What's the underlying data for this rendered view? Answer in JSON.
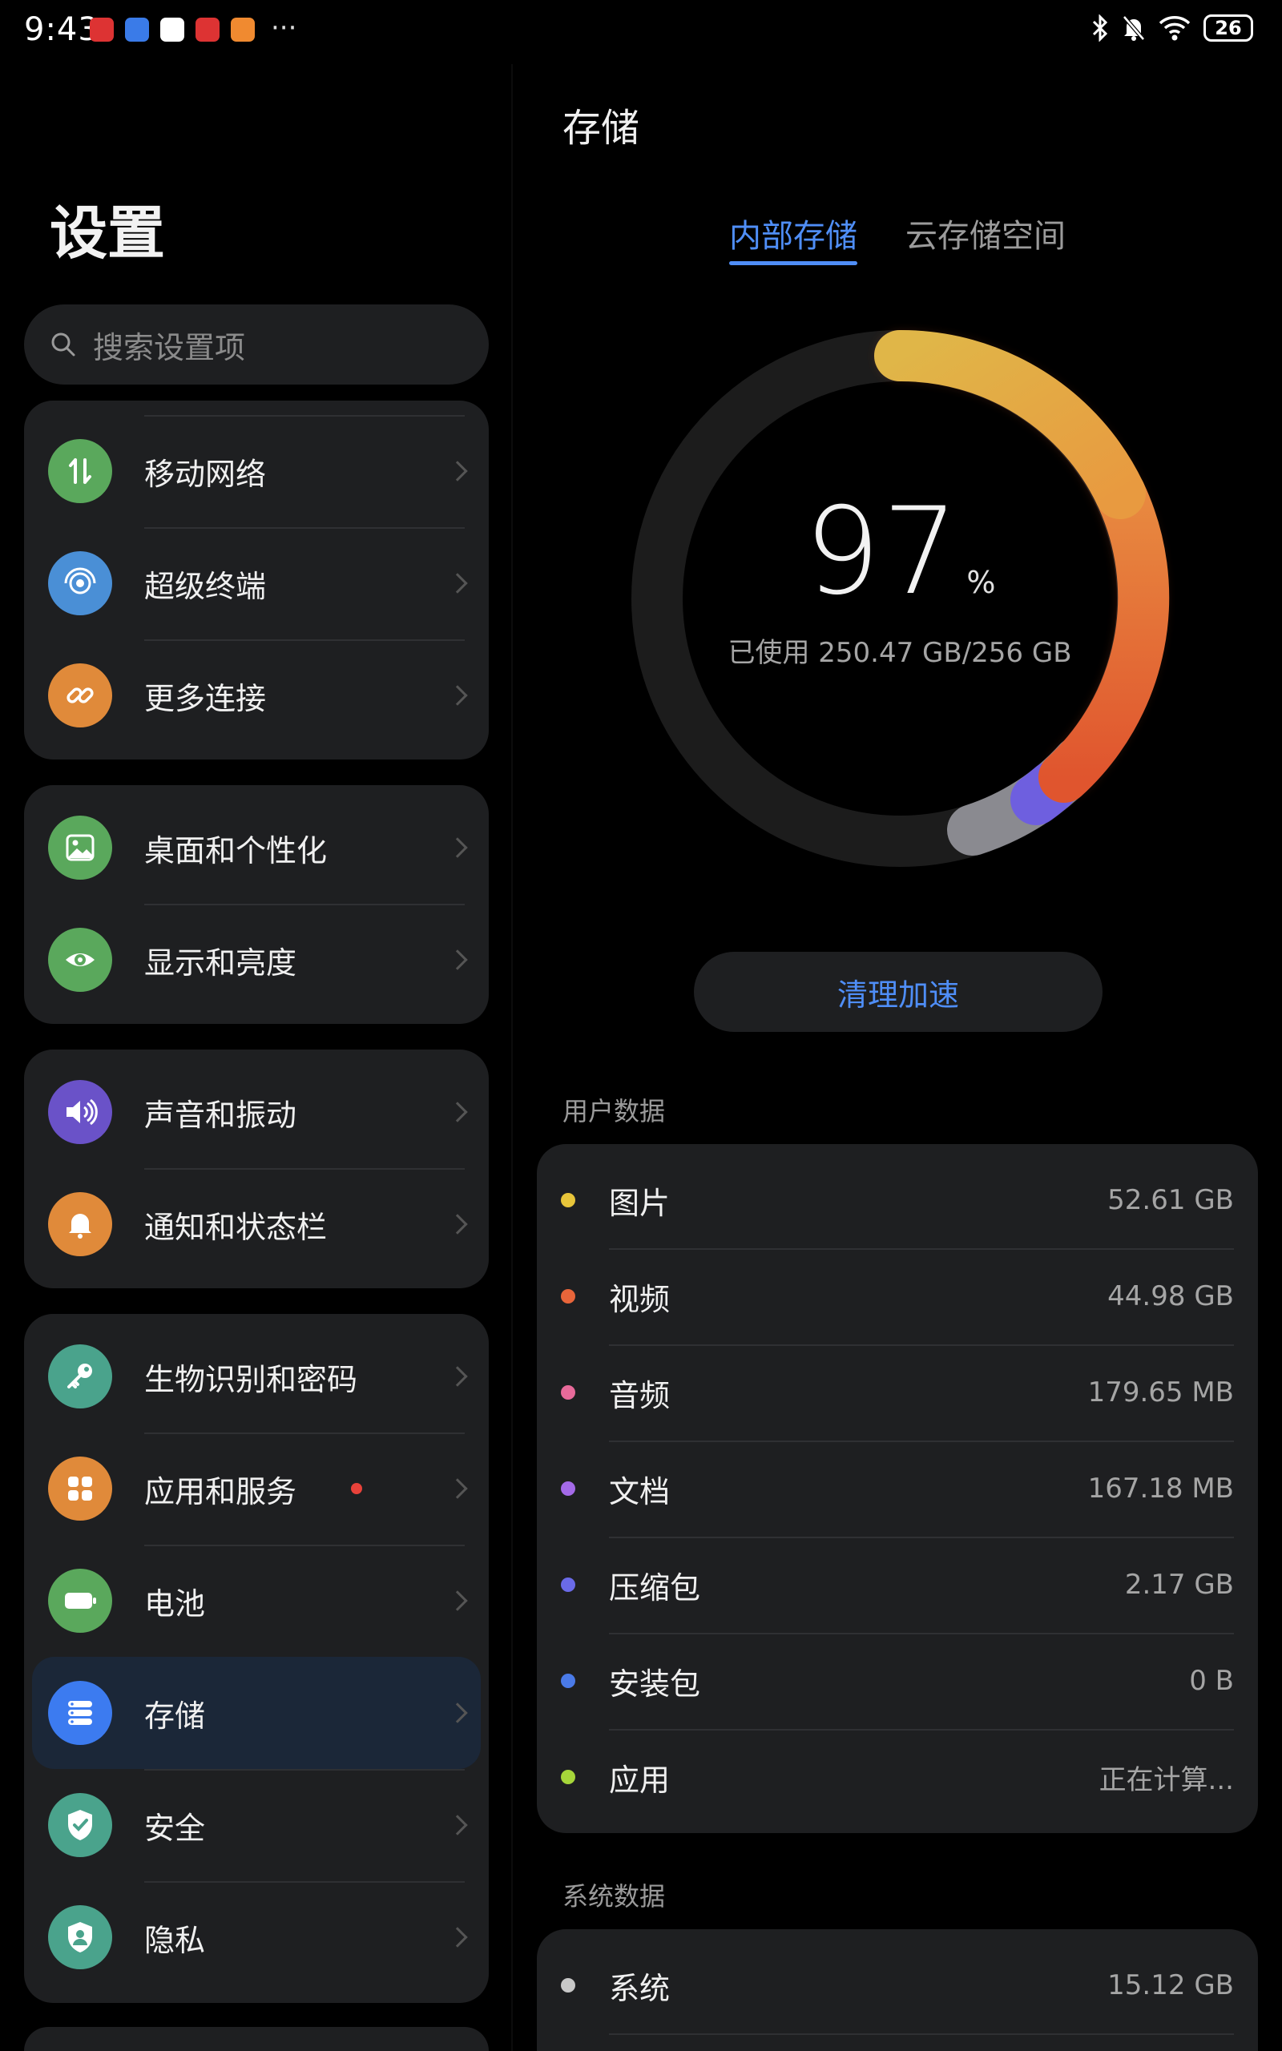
{
  "status_bar": {
    "time": "9:43",
    "battery": "26",
    "more": "···"
  },
  "left": {
    "title": "设置",
    "search_placeholder": "搜索设置项",
    "groups": [
      [
        {
          "label": "移动网络",
          "icon": "mobile-network-icon",
          "color": "#5aa85c"
        },
        {
          "label": "超级终端",
          "icon": "super-device-icon",
          "color": "#4a8fd6"
        },
        {
          "label": "更多连接",
          "icon": "link-icon",
          "color": "#e08a3a"
        }
      ],
      [
        {
          "label": "桌面和个性化",
          "icon": "wallpaper-icon",
          "color": "#5aa85c"
        },
        {
          "label": "显示和亮度",
          "icon": "eye-icon",
          "color": "#5aa85c"
        }
      ],
      [
        {
          "label": "声音和振动",
          "icon": "speaker-icon",
          "color": "#6a52c8"
        },
        {
          "label": "通知和状态栏",
          "icon": "bell-icon",
          "color": "#e08a3a"
        }
      ],
      [
        {
          "label": "生物识别和密码",
          "icon": "key-icon",
          "color": "#4aa38c"
        },
        {
          "label": "应用和服务",
          "icon": "apps-grid-icon",
          "color": "#e08a3a",
          "badge": true
        },
        {
          "label": "电池",
          "icon": "battery-icon",
          "color": "#5aa85c"
        },
        {
          "label": "存储",
          "icon": "storage-icon",
          "color": "#3c7bf0",
          "selected": true
        },
        {
          "label": "安全",
          "icon": "shield-check-icon",
          "color": "#4aa38c"
        },
        {
          "label": "隐私",
          "icon": "privacy-icon",
          "color": "#4aa38c"
        }
      ]
    ]
  },
  "right": {
    "title": "存储",
    "tabs": [
      "内部存储",
      "云存储空间"
    ],
    "percent": "97",
    "percent_symbol": "%",
    "used_text": "已使用 250.47 GB/256 GB",
    "clean_button": "清理加速",
    "user_section": "用户数据",
    "user_items": [
      {
        "name": "图片",
        "value": "52.61 GB",
        "color": "#e8c53a"
      },
      {
        "name": "视频",
        "value": "44.98 GB",
        "color": "#e8653a"
      },
      {
        "name": "音频",
        "value": "179.65 MB",
        "color": "#e86a9a"
      },
      {
        "name": "文档",
        "value": "167.18 MB",
        "color": "#a46ae8"
      },
      {
        "name": "压缩包",
        "value": "2.17 GB",
        "color": "#6a6ae8"
      },
      {
        "name": "安装包",
        "value": "0 B",
        "color": "#4a7ae8"
      },
      {
        "name": "应用",
        "value": "正在计算...",
        "color": "#a6d63a"
      }
    ],
    "system_section": "系统数据",
    "system_items": [
      {
        "name": "系统",
        "value": "15.12 GB",
        "color": "#c8c8c8"
      }
    ]
  }
}
